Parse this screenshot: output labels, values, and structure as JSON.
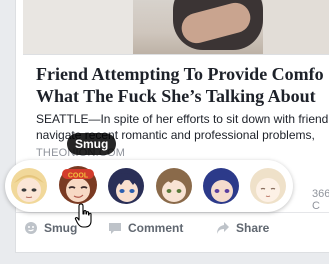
{
  "post": {
    "title_line1": "Friend Attempting To Provide Comfo",
    "title_line2": "What The Fuck She’s Talking About",
    "desc_line1": "SEATTLE—In spite of her efforts to sit down with friend",
    "desc_line2": "navigate recent romantic and professional problems,",
    "source": "THEONION.COM",
    "comments_count": "366 C"
  },
  "reactions": {
    "tooltip": "Smug",
    "faces": [
      {
        "name": "blonde-face-icon",
        "hair": "#f1d89a",
        "skin": "#fbe6d6"
      },
      {
        "name": "smug-face-icon",
        "hair": "#7a3a22",
        "skin": "#f7d9c4",
        "hat": "#d33b2c"
      },
      {
        "name": "navy-face-icon",
        "hair": "#2a2f57",
        "skin": "#f8dfcf"
      },
      {
        "name": "brown-face-icon",
        "hair": "#8a6a4a",
        "skin": "#f8e3d4"
      },
      {
        "name": "blue-face-icon",
        "hair": "#2c3a8a",
        "skin": "#f5dccd"
      },
      {
        "name": "pale-face-icon",
        "hair": "#efe1c9",
        "skin": "#fdf1e6"
      }
    ]
  },
  "actions": {
    "smug_label": "Smug",
    "comment_label": "Comment",
    "share_label": "Share"
  }
}
